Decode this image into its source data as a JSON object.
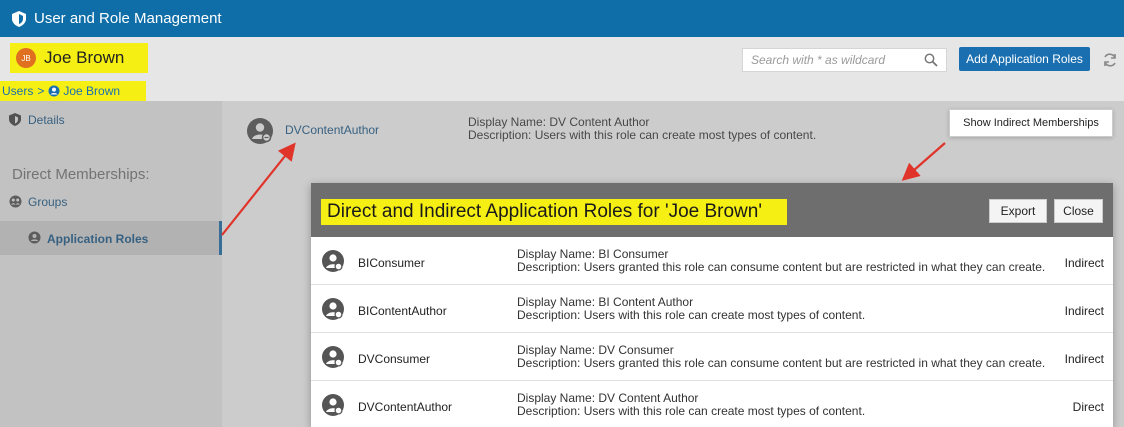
{
  "app": {
    "title": "User and Role Management"
  },
  "user": {
    "initials": "JB",
    "name": "Joe Brown"
  },
  "search": {
    "placeholder": "Search with * as wildcard"
  },
  "toolbar": {
    "add_label": "Add Application Roles"
  },
  "breadcrumb": {
    "root": "Users",
    "separator": ">",
    "current": "Joe Brown"
  },
  "sidebar": {
    "details": "Details",
    "heading": "Direct Memberships:",
    "groups": "Groups",
    "app_roles": "Application Roles"
  },
  "main_row": {
    "name": "DVContentAuthor",
    "display": "Display Name: DV Content Author",
    "description": "Description: Users with this role can create most types of content."
  },
  "menu": {
    "show_indirect": "Show Indirect Memberships"
  },
  "dialog": {
    "title": "Direct and Indirect Application Roles for 'Joe Brown'",
    "export_label": "Export",
    "close_label": "Close",
    "rows": [
      {
        "name": "BIConsumer",
        "display": "Display Name: BI Consumer",
        "description": "Description: Users granted this role can consume content but are restricted in what they can create.",
        "type": "Indirect"
      },
      {
        "name": "BIContentAuthor",
        "display": "Display Name: BI Content Author",
        "description": "Description: Users with this role can create most types of content.",
        "type": "Indirect"
      },
      {
        "name": "DVConsumer",
        "display": "Display Name: DV Consumer",
        "description": "Description: Users granted this role can consume content but are restricted in what they can create.",
        "type": "Indirect"
      },
      {
        "name": "DVContentAuthor",
        "display": "Display Name: DV Content Author",
        "description": "Description: Users with this role can create most types of content.",
        "type": "Direct"
      }
    ]
  },
  "colors": {
    "titlebar": "#0f6ea8",
    "highlight": "#f5ef13",
    "link": "#1a5a8c",
    "annotation": "#e0332a"
  }
}
